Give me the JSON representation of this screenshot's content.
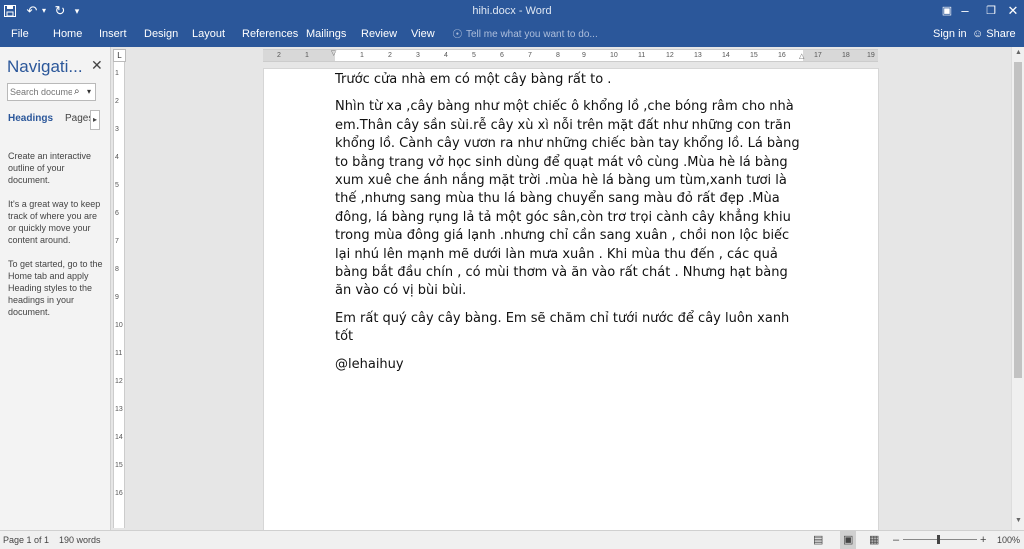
{
  "titlebar": {
    "title": "hihi.docx - Word",
    "save_icon": "save-icon",
    "undo_icon": "undo-icon",
    "redo_icon": "redo-icon",
    "customize_icon": "customize-toolbar-icon"
  },
  "ribbon": {
    "tabs": [
      "File",
      "Home",
      "Insert",
      "Design",
      "Layout",
      "References",
      "Mailings",
      "Review",
      "View"
    ],
    "tell_me": "Tell me what you want to do...",
    "sign_in": "Sign in",
    "share": "Share"
  },
  "nav": {
    "title": "Navigati...",
    "search_placeholder": "Search docume",
    "tab_headings": "Headings",
    "tab_pages": "Pages",
    "p1": "Create an interactive outline of your document.",
    "p2": "It's a great way to keep track of where you are or quickly move your content around.",
    "p3": "To get started, go to the Home tab and apply Heading styles to the headings in your document."
  },
  "ruler": {
    "h_numbers": [
      "2",
      "1",
      "1",
      "2",
      "3",
      "4",
      "5",
      "6",
      "7",
      "8",
      "9",
      "10",
      "11",
      "12",
      "13",
      "14",
      "15",
      "16",
      "17",
      "18",
      "19"
    ],
    "v_numbers": [
      "1",
      "2",
      "3",
      "4",
      "5",
      "6",
      "7",
      "8",
      "9",
      "10",
      "11",
      "12",
      "13",
      "14",
      "15",
      "16"
    ]
  },
  "document": {
    "paragraphs": [
      "Trước cửa nhà em có một cây bàng rất to .",
      " Nhìn từ xa ,cây bàng như một chiếc ô khổng lồ ,che bóng râm cho nhà em.Thân cây sần sùi.rễ cây xù xì nỗi trên mặt đất như những con trăn khổng lồ. Cành cây vươn ra như những chiếc bàn tay khổng lồ. Lá bàng to bằng trang vở học sinh dùng để quạt mát vô cùng .Mùa hè lá bàng xum xuê che ánh nắng mặt trời .mùa hè lá bàng um tùm,xanh tươi là thế ,nhưng sang mùa thu lá bàng chuyển sang màu đỏ rất đẹp .Mùa đông, lá bàng rụng lả tả một góc sân,còn trơ trọi cành cây khẳng khiu trong mùa đông giá lạnh .nhưng chỉ cần sang xuân , chồi non lộc biếc lại nhú lên mạnh mẽ dưới làn mưa xuân . Khi mùa thu đến , các quả bàng bắt đầu chín , có mùi thơm và ăn vào rất chát . Nhưng hạt bàng ăn vào có vị bùi bùi.",
      "Em rất quý cây cây bàng. Em sẽ chăm chỉ tưới nước để cây luôn xanh tốt",
      "@lehaihuy"
    ]
  },
  "status": {
    "page": "Page 1 of 1",
    "words": "190 words",
    "zoom": "100%",
    "zoom_minus": "–",
    "zoom_plus": "+"
  }
}
